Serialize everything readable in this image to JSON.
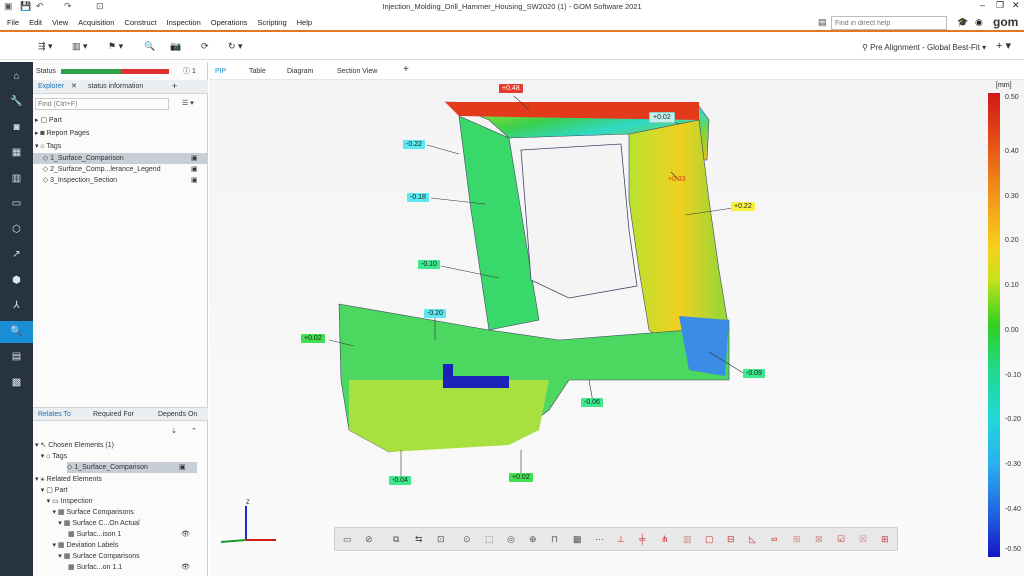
{
  "window": {
    "title": "Injection_Molding_Drill_Hammer_Housing_SW2020 (1) - GOM Software 2021",
    "controls": [
      "–",
      "❐",
      "✕"
    ]
  },
  "menu": [
    "File",
    "Edit",
    "View",
    "Acquisition",
    "Construct",
    "Inspection",
    "Operations",
    "Scripting",
    "Help"
  ],
  "search": {
    "placeholder": "Find in direct help"
  },
  "brand": "gom",
  "toolbar": {
    "alignment": "Pre Alignment - Global Best-Fit"
  },
  "panel": {
    "status_label": "Status",
    "status_count": "1",
    "tabs": [
      "Explorer",
      "status information"
    ],
    "find_placeholder": "Find (Ctrl+F)",
    "tree": [
      "Part",
      "Report Pages",
      "Tags",
      "1_Surface_Comparison",
      "2_Surface_Comp...lerance_Legend",
      "3_Inspection_Section"
    ],
    "bottom_tabs": [
      "Relates To",
      "Required For",
      "Depends On"
    ],
    "rel_tree": [
      "Chosen Elements (1)",
      "Tags",
      "1_Surface_Comparison",
      "Related Elements",
      "Part",
      "Inspection",
      "Surface Comparisons",
      "Surface C...On Actual",
      "Surfac...ison 1",
      "Deviation Labels",
      "Surface Comparisons",
      "Surfac...on 1.1"
    ]
  },
  "view_tabs": [
    "PIP",
    "Table",
    "Diagram",
    "Section View",
    "+"
  ],
  "labels": [
    "+0.48",
    "+0.02",
    "-0.22",
    "+0.33",
    "-0.18",
    "+0.22",
    "-0.10",
    "-0.20",
    "+0.02",
    "-0.09",
    "-0.06",
    "-0.04",
    "+0.02"
  ],
  "colors": {
    "accent": "#e07828",
    "nav_active": "#1a8fd5",
    "sidebar_bg": "#27333f"
  },
  "scale": {
    "unit": "[mm]",
    "ticks": [
      "0.50",
      "0.40",
      "0.30",
      "0.20",
      "0.10",
      "0.00",
      "-0.10",
      "-0.20",
      "-0.30",
      "-0.40",
      "-0.50"
    ]
  },
  "axes": {
    "z": "Z"
  }
}
